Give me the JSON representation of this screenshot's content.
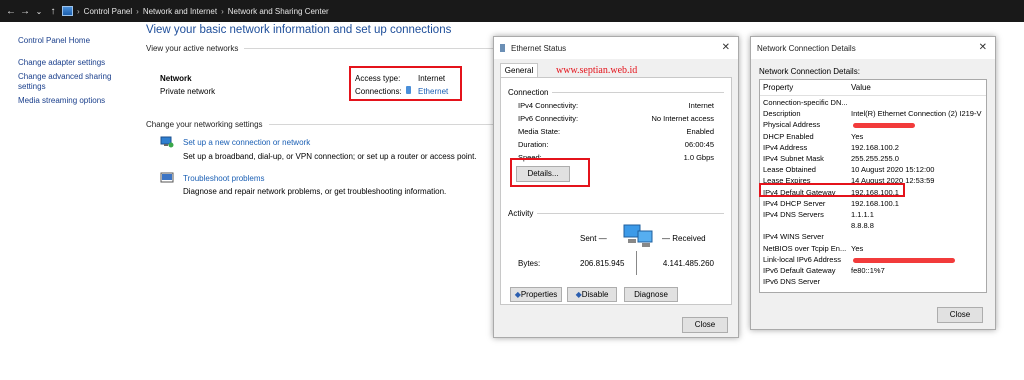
{
  "addressbar": {
    "crumbs": [
      "Control Panel",
      "Network and Internet",
      "Network and Sharing Center"
    ],
    "nav": {
      "back": "←",
      "forward": "→",
      "down": "⌄",
      "up": "↑"
    },
    "sep": "›"
  },
  "leftpane": {
    "home": "Control Panel Home",
    "items": [
      "Change adapter settings",
      "Change advanced sharing settings",
      "Media streaming options"
    ]
  },
  "main": {
    "title": "View your basic network information and set up connections",
    "active_header": "View your active networks",
    "network_name": "Network",
    "network_type": "Private network",
    "access_type_label": "Access type:",
    "access_type_value": "Internet",
    "connections_label": "Connections:",
    "connections_value": "Ethernet",
    "change_header": "Change your networking settings",
    "tasks": [
      {
        "title": "Set up a new connection or network",
        "desc": "Set up a broadband, dial-up, or VPN connection; or set up a router or access point."
      },
      {
        "title": "Troubleshoot problems",
        "desc": "Diagnose and repair network problems, or get troubleshooting information."
      }
    ]
  },
  "status": {
    "title": "Ethernet Status",
    "tab": "General",
    "watermark": "www.septian.web.id",
    "connection_header": "Connection",
    "rows": [
      {
        "label": "IPv4 Connectivity:",
        "value": "Internet"
      },
      {
        "label": "IPv6 Connectivity:",
        "value": "No Internet access"
      },
      {
        "label": "Media State:",
        "value": "Enabled"
      },
      {
        "label": "Duration:",
        "value": "06:00:45"
      },
      {
        "label": "Speed:",
        "value": "1.0 Gbps"
      }
    ],
    "details_btn": "Details...",
    "activity_header": "Activity",
    "sent": "Sent",
    "received": "Received",
    "bytes_label": "Bytes:",
    "bytes_sent": "206.815.945",
    "bytes_received": "4.141.485.260",
    "btn_properties": "Properties",
    "btn_disable": "Disable",
    "btn_diagnose": "Diagnose",
    "btn_close": "Close"
  },
  "details": {
    "title": "Network Connection Details",
    "subtitle": "Network Connection Details:",
    "col_property": "Property",
    "col_value": "Value",
    "rows": [
      {
        "p": "Connection-specific DN...",
        "v": ""
      },
      {
        "p": "Description",
        "v": "Intel(R) Ethernet Connection (2) I219-V"
      },
      {
        "p": "Physical Address",
        "v": ""
      },
      {
        "p": "DHCP Enabled",
        "v": "Yes"
      },
      {
        "p": "IPv4 Address",
        "v": "192.168.100.2"
      },
      {
        "p": "IPv4 Subnet Mask",
        "v": "255.255.255.0"
      },
      {
        "p": "Lease Obtained",
        "v": "10 August 2020 15:12:00"
      },
      {
        "p": "Lease Expires",
        "v": "14 August 2020 12:53:59"
      },
      {
        "p": "IPv4 Default Gateway",
        "v": "192.168.100.1"
      },
      {
        "p": "IPv4 DHCP Server",
        "v": "192.168.100.1"
      },
      {
        "p": "IPv4 DNS Servers",
        "v": "1.1.1.1"
      },
      {
        "p": "",
        "v": "8.8.8.8"
      },
      {
        "p": "IPv4 WINS Server",
        "v": ""
      },
      {
        "p": "NetBIOS over Tcpip En...",
        "v": "Yes"
      },
      {
        "p": "Link-local IPv6 Address",
        "v": ""
      },
      {
        "p": "IPv6 Default Gateway",
        "v": "fe80::1%7"
      },
      {
        "p": "IPv6 DNS Server",
        "v": ""
      }
    ],
    "btn_close": "Close"
  },
  "colors": {
    "highlight": "#e4131b",
    "link": "#1a5fb4",
    "titlebar": "#191919"
  }
}
